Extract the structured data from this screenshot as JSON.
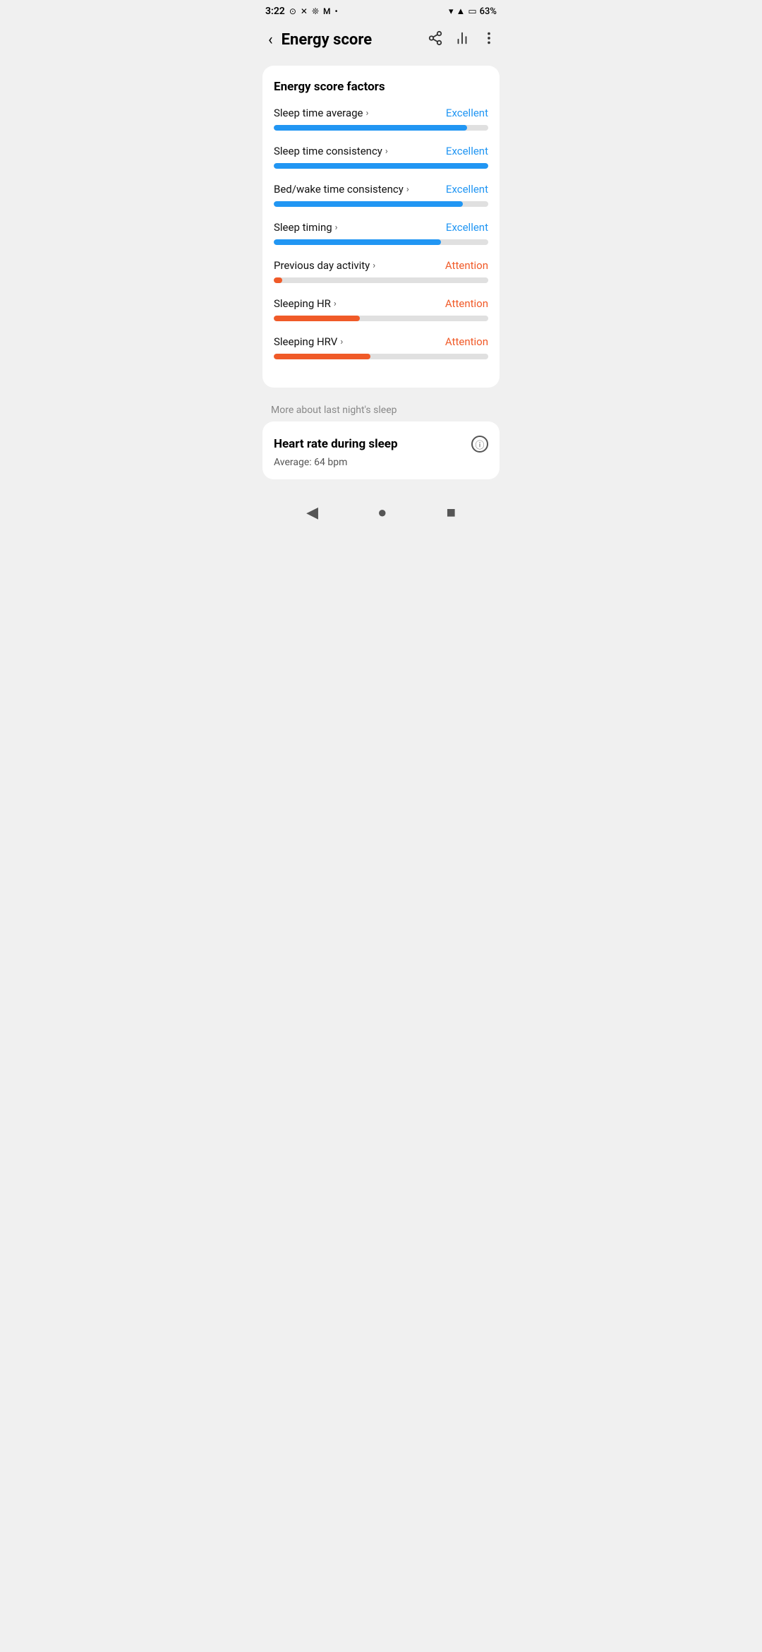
{
  "statusBar": {
    "time": "3:22",
    "icons": [
      "📷",
      "✕",
      "🐾",
      "M",
      "•"
    ],
    "battery": "63%"
  },
  "header": {
    "title": "Energy score",
    "backLabel": "‹",
    "shareIcon": "share",
    "chartIcon": "chart",
    "moreIcon": "more"
  },
  "energyScore": {
    "sectionTitle": "Energy score factors",
    "factors": [
      {
        "label": "Sleep time average",
        "status": "Excellent",
        "statusType": "excellent",
        "progressPercent": 90
      },
      {
        "label": "Sleep time consistency",
        "status": "Excellent",
        "statusType": "excellent",
        "progressPercent": 100
      },
      {
        "label": "Bed/wake time consistency",
        "status": "Excellent",
        "statusType": "excellent",
        "progressPercent": 88
      },
      {
        "label": "Sleep timing",
        "status": "Excellent",
        "statusType": "excellent",
        "progressPercent": 78
      },
      {
        "label": "Previous day activity",
        "status": "Attention",
        "statusType": "attention",
        "progressPercent": 4
      },
      {
        "label": "Sleeping HR",
        "status": "Attention",
        "statusType": "attention",
        "progressPercent": 40
      },
      {
        "label": "Sleeping HRV",
        "status": "Attention",
        "statusType": "attention",
        "progressPercent": 45
      }
    ]
  },
  "moreSection": {
    "label": "More about last night's sleep"
  },
  "heartRate": {
    "title": "Heart rate during sleep",
    "subtitle": "Average: 64 bpm"
  },
  "navBar": {
    "back": "◀",
    "home": "●",
    "recent": "■"
  }
}
